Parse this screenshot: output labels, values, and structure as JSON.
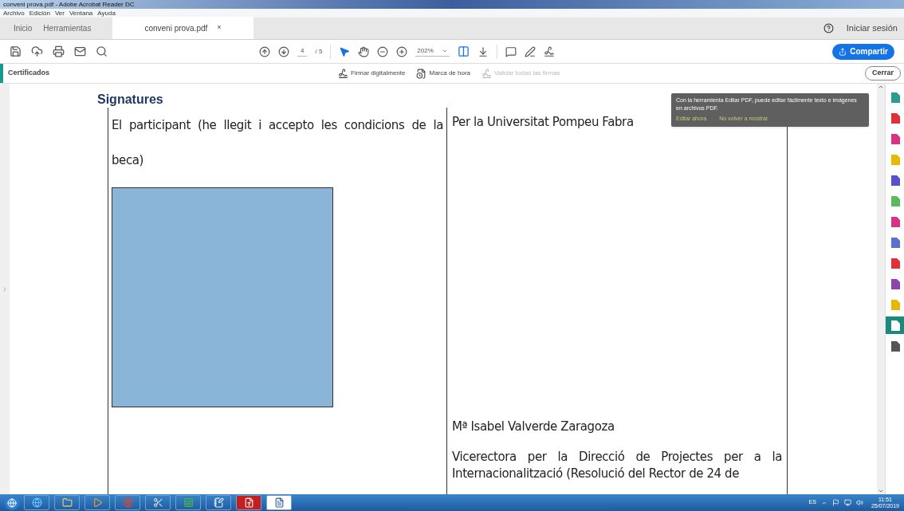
{
  "window": {
    "title": "conveni prova.pdf - Adobe Acrobat Reader DC"
  },
  "menu": [
    "Archivo",
    "Edición",
    "Ver",
    "Ventana",
    "Ayuda"
  ],
  "tabs": [
    {
      "label": "Inicio",
      "selected": false,
      "kind": "nav"
    },
    {
      "label": "Herramientas",
      "selected": false,
      "kind": "nav"
    },
    {
      "label": "conveni prova.pdf",
      "selected": true,
      "kind": "document",
      "close": "×"
    }
  ],
  "header_right": {
    "sign_in": "Iniciar sesión"
  },
  "toolbar": {
    "page_current": "4",
    "page_total": "/ 5",
    "zoom": "202%",
    "share": "Compartir"
  },
  "certificates_bar": {
    "title": "Certificados",
    "tools": [
      {
        "label": "Firmar digitalmente",
        "disabled": false,
        "kind": "sign"
      },
      {
        "label": "Marca de hora",
        "disabled": false,
        "kind": "time"
      },
      {
        "label": "Validar todas las firmas",
        "disabled": true,
        "kind": "sign"
      }
    ],
    "close": "Cerrar"
  },
  "document": {
    "heading": "Signatures",
    "left_text": "El participant  (he llegit i accepto les condicions de la beca)",
    "right_title": "Per la Universitat Pompeu Fabra",
    "signer": "Mª Isabel Valverde Zaragoza",
    "role": "Vicerectora per la Direcció de Projectes per a la Internacionalització (Resolució del Rector de 24 de"
  },
  "tooltip": {
    "text": "Con la herramienta Editar PDF, puede editar fácilmente texto e imágenes en archivos PDF.",
    "actions": [
      "Editar ahora",
      "No volver a mostrar"
    ]
  },
  "right_rail": [
    {
      "color": "#2a9d8f",
      "selected": false
    },
    {
      "color": "#e0303a",
      "selected": false
    },
    {
      "color": "#d63384",
      "selected": false
    },
    {
      "color": "#e6b800",
      "selected": false
    },
    {
      "color": "#5a4fcf",
      "selected": false
    },
    {
      "color": "#5cb85c",
      "selected": false
    },
    {
      "color": "#d63384",
      "selected": false
    },
    {
      "color": "#5a6fcf",
      "selected": false
    },
    {
      "color": "#e0303a",
      "selected": false
    },
    {
      "color": "#8e44ad",
      "selected": false
    },
    {
      "color": "#e6b800",
      "selected": false
    },
    {
      "color": "#ffffff",
      "selected": true
    },
    {
      "color": "#555555",
      "selected": false
    }
  ],
  "taskbar": {
    "language": "ES",
    "time": "11:51",
    "date": "25/07/2019"
  }
}
